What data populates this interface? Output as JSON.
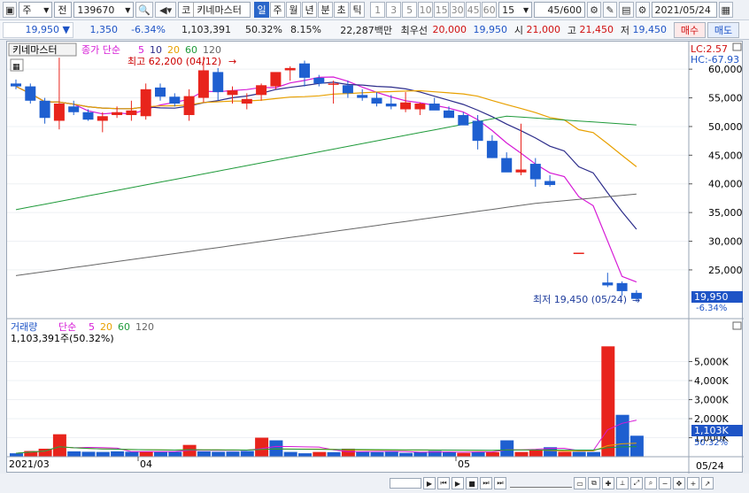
{
  "toolbar": {
    "market_type": "주",
    "market_sel": "전",
    "code": "139670",
    "name_prefix": "코",
    "stock_name": "키네마스터",
    "periods": [
      {
        "label": "일",
        "active": true
      },
      {
        "label": "주",
        "active": false
      },
      {
        "label": "월",
        "active": false
      },
      {
        "label": "년",
        "active": false
      },
      {
        "label": "분",
        "active": false
      },
      {
        "label": "초",
        "active": false
      },
      {
        "label": "틱",
        "active": false
      }
    ],
    "intervals": [
      "1",
      "3",
      "5",
      "10",
      "15",
      "30",
      "45",
      "60"
    ],
    "interval_sel": "15",
    "count": "45",
    "count_max": "/600",
    "date": "2021/05/24"
  },
  "quote": {
    "price": "19,950",
    "change": "1,350",
    "change_pct": "-6.34%",
    "volume": "1,103,391",
    "vol_ratio": "50.32%",
    "turnover_rate": "8.15%",
    "amount": "22,287백만",
    "bid_label": "최우선",
    "bid": "20,000",
    "ask": "19,950",
    "open_label": "시",
    "open": "21,000",
    "high_label": "고",
    "high": "21,450",
    "low_label": "저",
    "low": "19,450",
    "buy": "매수",
    "sell": "매도"
  },
  "price_panel": {
    "legend_name": "키네마스터",
    "legend_ma_label": "종가 단순",
    "ma_periods": [
      "5",
      "10",
      "20",
      "60",
      "120"
    ],
    "ma_colors": [
      "#d61ad6",
      "#2c2c8a",
      "#e8a000",
      "#1f9a3a",
      "#666666"
    ],
    "max_label": "최고 62,200 (04/12)",
    "min_label": "최저 19,450 (05/24)",
    "lc": "LC:2.57",
    "hc": "HC:-67.93",
    "current_price": "19,950",
    "current_pct": "-6.34%",
    "y_ticks": [
      "60,000",
      "55,000",
      "50,000",
      "45,000",
      "40,000",
      "35,000",
      "30,000",
      "25,000"
    ]
  },
  "volume_panel": {
    "legend_name": "거래량",
    "legend_ma_label": "단순",
    "ma_periods": [
      "5",
      "20",
      "60",
      "120"
    ],
    "current_label": "1,103,391주(50.32%)",
    "current_vol": "1,103K",
    "current_pct": "50.32%",
    "y_ticks": [
      "5,000K",
      "4,000K",
      "3,000K",
      "2,000K",
      "1,000K"
    ]
  },
  "x_axis": {
    "labels": [
      "2021/03",
      "04",
      "05"
    ],
    "right_label": "05/24"
  },
  "chart_data": {
    "type": "candlestick",
    "ylim": [
      16500,
      64500
    ],
    "volume_ylim": [
      0,
      6000
    ],
    "candles": [
      [
        57500,
        58200,
        56500,
        57000
      ],
      [
        57000,
        57500,
        54000,
        54500
      ],
      [
        54500,
        55000,
        50500,
        51500
      ],
      [
        51000,
        62000,
        49500,
        54000
      ],
      [
        53500,
        54500,
        52000,
        52500
      ],
      [
        52500,
        53000,
        51000,
        51200
      ],
      [
        51000,
        52500,
        49000,
        51800
      ],
      [
        52000,
        53500,
        51500,
        52500
      ],
      [
        52000,
        54500,
        51000,
        52800
      ],
      [
        51800,
        57500,
        51200,
        56500
      ],
      [
        56800,
        57500,
        54500,
        55200
      ],
      [
        55200,
        55800,
        53500,
        54000
      ],
      [
        52000,
        56500,
        51000,
        55300
      ],
      [
        55000,
        62200,
        54200,
        59800
      ],
      [
        59500,
        60200,
        54500,
        56000
      ],
      [
        55500,
        57000,
        54000,
        56300
      ],
      [
        54000,
        55800,
        53000,
        54800
      ],
      [
        55500,
        57500,
        54500,
        57200
      ],
      [
        57000,
        59000,
        56500,
        59500
      ],
      [
        59800,
        60500,
        58000,
        60200
      ],
      [
        61000,
        61500,
        57000,
        58500
      ],
      [
        58500,
        59000,
        57000,
        57500
      ],
      [
        57500,
        58000,
        54000,
        57500
      ],
      [
        57200,
        58000,
        55000,
        55800
      ],
      [
        55500,
        56500,
        54500,
        55000
      ],
      [
        55000,
        56000,
        53500,
        54000
      ],
      [
        54000,
        55500,
        53000,
        53500
      ],
      [
        53000,
        56000,
        52500,
        54200
      ],
      [
        53000,
        54200,
        52000,
        54000
      ],
      [
        54000,
        55000,
        53000,
        52800
      ],
      [
        52800,
        53500,
        51500,
        51500
      ],
      [
        52000,
        52500,
        50500,
        50200
      ],
      [
        51000,
        52000,
        46000,
        47500
      ],
      [
        47500,
        48500,
        44500,
        44500
      ],
      [
        44500,
        45500,
        42500,
        42000
      ],
      [
        42000,
        50500,
        41500,
        42500
      ],
      [
        43500,
        44500,
        39500,
        40800
      ],
      [
        40500,
        41500,
        39500,
        39800
      ],
      [
        null,
        null,
        null,
        null
      ],
      [
        28000,
        28000,
        28000,
        28000
      ],
      [
        null,
        null,
        null,
        null
      ],
      [
        22800,
        24500,
        22000,
        22300
      ],
      [
        22700,
        23000,
        20500,
        21300
      ],
      [
        21000,
        21450,
        19450,
        19950
      ]
    ],
    "volume": [
      180,
      300,
      420,
      1180,
      280,
      260,
      250,
      280,
      260,
      280,
      250,
      260,
      620,
      280,
      260,
      270,
      300,
      1000,
      860,
      250,
      180,
      250,
      240,
      420,
      250,
      240,
      260,
      200,
      240,
      300,
      250,
      200,
      260,
      240,
      860,
      250,
      340,
      500,
      260,
      260,
      250,
      5800,
      2200,
      1103
    ],
    "volume_colors": [
      "b",
      "r",
      "r",
      "r",
      "b",
      "b",
      "b",
      "b",
      "b",
      "r",
      "b",
      "b",
      "r",
      "b",
      "b",
      "b",
      "b",
      "r",
      "b",
      "b",
      "b",
      "r",
      "b",
      "r",
      "b",
      "b",
      "b",
      "b",
      "b",
      "b",
      "b",
      "r",
      "b",
      "r",
      "b",
      "r",
      "r",
      "b",
      "r",
      "b",
      "b",
      "r",
      "b",
      "b"
    ]
  },
  "status_icons": [
    "prev-icon",
    "first-icon",
    "play-icon",
    "stop-icon",
    "next-icon",
    "last-icon",
    "scroll-icon",
    "zoom-out-icon",
    "zoom-in-icon"
  ]
}
